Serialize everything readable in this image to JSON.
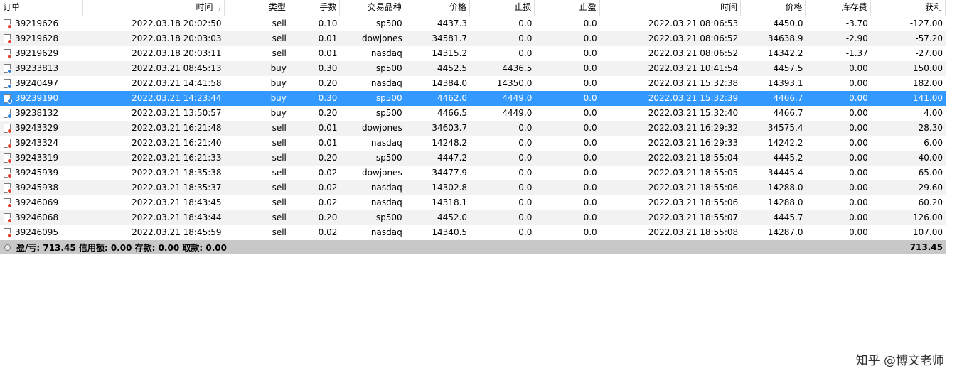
{
  "columns": [
    "订单",
    "时间",
    "类型",
    "手数",
    "交易品种",
    "价格",
    "止损",
    "止盈",
    "时间",
    "价格",
    "库存费",
    "获利"
  ],
  "sort_indicator": "/",
  "rows": [
    {
      "order": "39219626",
      "open_time": "2022.03.18 20:02:50",
      "type": "sell",
      "lots": "0.10",
      "symbol": "sp500",
      "open_price": "4437.3",
      "sl": "0.0",
      "tp": "0.0",
      "close_time": "2022.03.21 08:06:53",
      "close_price": "4450.0",
      "swap": "-3.70",
      "profit": "-127.00"
    },
    {
      "order": "39219628",
      "open_time": "2022.03.18 20:03:03",
      "type": "sell",
      "lots": "0.01",
      "symbol": "dowjones",
      "open_price": "34581.7",
      "sl": "0.0",
      "tp": "0.0",
      "close_time": "2022.03.21 08:06:52",
      "close_price": "34638.9",
      "swap": "-2.90",
      "profit": "-57.20"
    },
    {
      "order": "39219629",
      "open_time": "2022.03.18 20:03:11",
      "type": "sell",
      "lots": "0.01",
      "symbol": "nasdaq",
      "open_price": "14315.2",
      "sl": "0.0",
      "tp": "0.0",
      "close_time": "2022.03.21 08:06:52",
      "close_price": "14342.2",
      "swap": "-1.37",
      "profit": "-27.00"
    },
    {
      "order": "39233813",
      "open_time": "2022.03.21 08:45:13",
      "type": "buy",
      "lots": "0.30",
      "symbol": "sp500",
      "open_price": "4452.5",
      "sl": "4436.5",
      "tp": "0.0",
      "close_time": "2022.03.21 10:41:54",
      "close_price": "4457.5",
      "swap": "0.00",
      "profit": "150.00"
    },
    {
      "order": "39240497",
      "open_time": "2022.03.21 14:41:58",
      "type": "buy",
      "lots": "0.20",
      "symbol": "nasdaq",
      "open_price": "14384.0",
      "sl": "14350.0",
      "tp": "0.0",
      "close_time": "2022.03.21 15:32:38",
      "close_price": "14393.1",
      "swap": "0.00",
      "profit": "182.00"
    },
    {
      "order": "39239190",
      "open_time": "2022.03.21 14:23:44",
      "type": "buy",
      "lots": "0.30",
      "symbol": "sp500",
      "open_price": "4462.0",
      "sl": "4449.0",
      "tp": "0.0",
      "close_time": "2022.03.21 15:32:39",
      "close_price": "4466.7",
      "swap": "0.00",
      "profit": "141.00",
      "selected": true
    },
    {
      "order": "39238132",
      "open_time": "2022.03.21 13:50:57",
      "type": "buy",
      "lots": "0.20",
      "symbol": "sp500",
      "open_price": "4466.5",
      "sl": "4449.0",
      "tp": "0.0",
      "close_time": "2022.03.21 15:32:40",
      "close_price": "4466.7",
      "swap": "0.00",
      "profit": "4.00"
    },
    {
      "order": "39243329",
      "open_time": "2022.03.21 16:21:48",
      "type": "sell",
      "lots": "0.01",
      "symbol": "dowjones",
      "open_price": "34603.7",
      "sl": "0.0",
      "tp": "0.0",
      "close_time": "2022.03.21 16:29:32",
      "close_price": "34575.4",
      "swap": "0.00",
      "profit": "28.30"
    },
    {
      "order": "39243324",
      "open_time": "2022.03.21 16:21:40",
      "type": "sell",
      "lots": "0.01",
      "symbol": "nasdaq",
      "open_price": "14248.2",
      "sl": "0.0",
      "tp": "0.0",
      "close_time": "2022.03.21 16:29:33",
      "close_price": "14242.2",
      "swap": "0.00",
      "profit": "6.00"
    },
    {
      "order": "39243319",
      "open_time": "2022.03.21 16:21:33",
      "type": "sell",
      "lots": "0.20",
      "symbol": "sp500",
      "open_price": "4447.2",
      "sl": "0.0",
      "tp": "0.0",
      "close_time": "2022.03.21 18:55:04",
      "close_price": "4445.2",
      "swap": "0.00",
      "profit": "40.00"
    },
    {
      "order": "39245939",
      "open_time": "2022.03.21 18:35:38",
      "type": "sell",
      "lots": "0.02",
      "symbol": "dowjones",
      "open_price": "34477.9",
      "sl": "0.0",
      "tp": "0.0",
      "close_time": "2022.03.21 18:55:05",
      "close_price": "34445.4",
      "swap": "0.00",
      "profit": "65.00"
    },
    {
      "order": "39245938",
      "open_time": "2022.03.21 18:35:37",
      "type": "sell",
      "lots": "0.02",
      "symbol": "nasdaq",
      "open_price": "14302.8",
      "sl": "0.0",
      "tp": "0.0",
      "close_time": "2022.03.21 18:55:06",
      "close_price": "14288.0",
      "swap": "0.00",
      "profit": "29.60"
    },
    {
      "order": "39246069",
      "open_time": "2022.03.21 18:43:45",
      "type": "sell",
      "lots": "0.02",
      "symbol": "nasdaq",
      "open_price": "14318.1",
      "sl": "0.0",
      "tp": "0.0",
      "close_time": "2022.03.21 18:55:06",
      "close_price": "14288.0",
      "swap": "0.00",
      "profit": "60.20"
    },
    {
      "order": "39246068",
      "open_time": "2022.03.21 18:43:44",
      "type": "sell",
      "lots": "0.20",
      "symbol": "sp500",
      "open_price": "4452.0",
      "sl": "0.0",
      "tp": "0.0",
      "close_time": "2022.03.21 18:55:07",
      "close_price": "4445.7",
      "swap": "0.00",
      "profit": "126.00"
    },
    {
      "order": "39246095",
      "open_time": "2022.03.21 18:45:59",
      "type": "sell",
      "lots": "0.02",
      "symbol": "nasdaq",
      "open_price": "14340.5",
      "sl": "0.0",
      "tp": "0.0",
      "close_time": "2022.03.21 18:55:08",
      "close_price": "14287.0",
      "swap": "0.00",
      "profit": "107.00"
    }
  ],
  "footer": {
    "summary": "盈/亏: 713.45  信用额: 0.00  存款: 0.00  取款: 0.00",
    "total": "713.45"
  },
  "watermark": "知乎 @博文老师",
  "colors": {
    "selected_row": "#3399ff",
    "alt_row": "#f2f2f2",
    "footer": "#c8c8c8",
    "sell_dot": "#e0402a",
    "buy_dot": "#2d7fd8"
  }
}
